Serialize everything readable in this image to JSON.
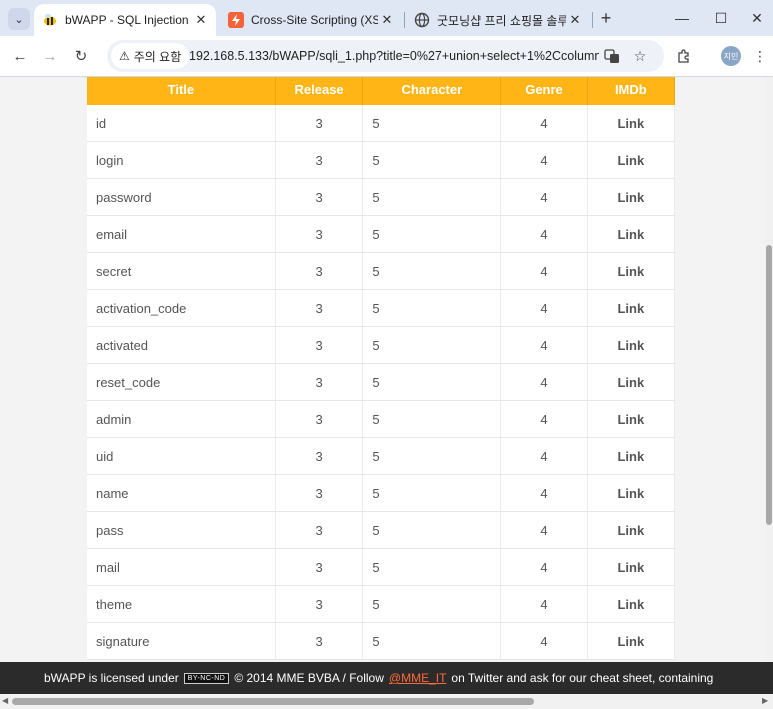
{
  "browser": {
    "tabs": [
      {
        "title": "bWAPP - SQL Injection",
        "icon": "bee-icon"
      },
      {
        "title": "Cross-Site Scripting (XSS)",
        "icon": "bolt-icon"
      },
      {
        "title": "굿모닝샵 프리 쇼핑몰 솔루",
        "icon": "globe-icon"
      }
    ],
    "security_label": "주의 요함",
    "url": "192.168.5.133/bWAPP/sqli_1.php?title=0%27+union+select+1%2Ccolumn...",
    "profile_label": "지민"
  },
  "table": {
    "headers": [
      "Title",
      "Release",
      "Character",
      "Genre",
      "IMDb"
    ],
    "rows": [
      {
        "title": "id",
        "release": "3",
        "character": "5",
        "genre": "4",
        "imdb": "Link"
      },
      {
        "title": "login",
        "release": "3",
        "character": "5",
        "genre": "4",
        "imdb": "Link"
      },
      {
        "title": "password",
        "release": "3",
        "character": "5",
        "genre": "4",
        "imdb": "Link"
      },
      {
        "title": "email",
        "release": "3",
        "character": "5",
        "genre": "4",
        "imdb": "Link"
      },
      {
        "title": "secret",
        "release": "3",
        "character": "5",
        "genre": "4",
        "imdb": "Link"
      },
      {
        "title": "activation_code",
        "release": "3",
        "character": "5",
        "genre": "4",
        "imdb": "Link"
      },
      {
        "title": "activated",
        "release": "3",
        "character": "5",
        "genre": "4",
        "imdb": "Link"
      },
      {
        "title": "reset_code",
        "release": "3",
        "character": "5",
        "genre": "4",
        "imdb": "Link"
      },
      {
        "title": "admin",
        "release": "3",
        "character": "5",
        "genre": "4",
        "imdb": "Link"
      },
      {
        "title": "uid",
        "release": "3",
        "character": "5",
        "genre": "4",
        "imdb": "Link"
      },
      {
        "title": "name",
        "release": "3",
        "character": "5",
        "genre": "4",
        "imdb": "Link"
      },
      {
        "title": "pass",
        "release": "3",
        "character": "5",
        "genre": "4",
        "imdb": "Link"
      },
      {
        "title": "mail",
        "release": "3",
        "character": "5",
        "genre": "4",
        "imdb": "Link"
      },
      {
        "title": "theme",
        "release": "3",
        "character": "5",
        "genre": "4",
        "imdb": "Link"
      },
      {
        "title": "signature",
        "release": "3",
        "character": "5",
        "genre": "4",
        "imdb": "Link"
      }
    ]
  },
  "footer": {
    "prefix": "bWAPP is licensed under",
    "badge": "BY-NC-ND",
    "middle": "© 2014 MME BVBA / Follow",
    "twitter": "@MME_IT",
    "suffix": "on Twitter and ask for our cheat sheet, containing"
  },
  "colors": {
    "header_bg": "#ffb515",
    "footer_bg": "#2b2b2b",
    "twitter_link": "#ff6a3a"
  }
}
